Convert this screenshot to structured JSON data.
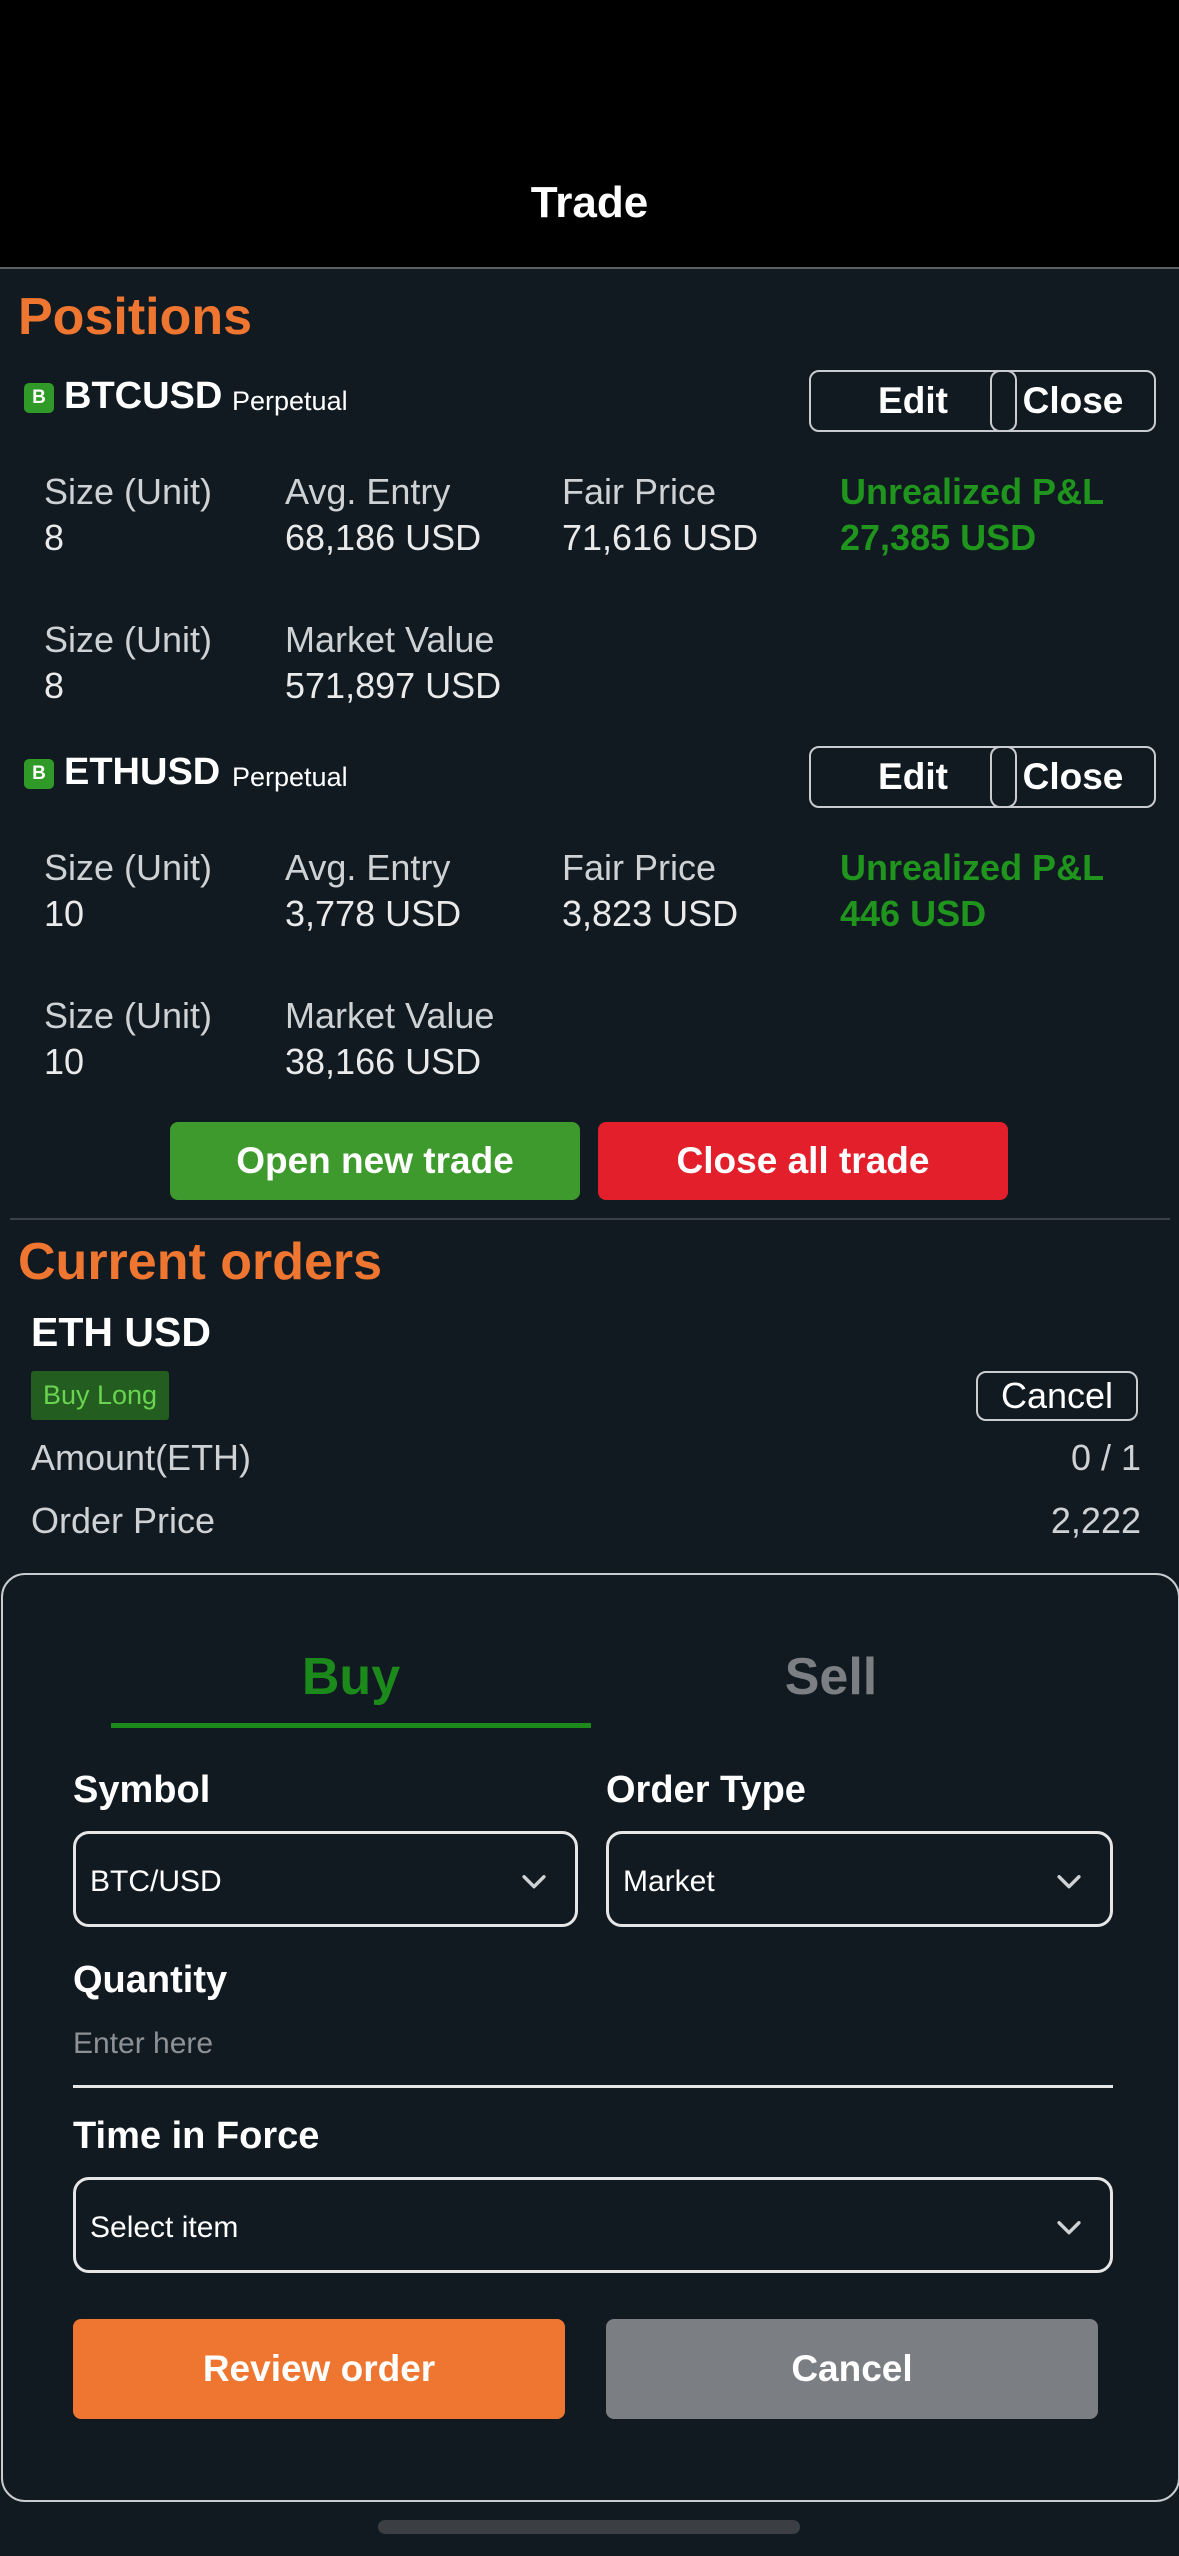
{
  "header": {
    "title": "Trade"
  },
  "positions": {
    "title": "Positions",
    "items": [
      {
        "badge": "B",
        "symbol": "BTCUSD",
        "type": "Perpetual",
        "edit_label": "Edit",
        "close_label": "Close",
        "stats": [
          {
            "label": "Size (Unit)",
            "value": "8"
          },
          {
            "label": "Avg. Entry",
            "value": "68,186 USD"
          },
          {
            "label": "Fair Price",
            "value": "71,616 USD"
          },
          {
            "label": "Unrealized P&L",
            "value": "27,385 USD"
          },
          {
            "label": "Size (Unit)",
            "value": "8"
          },
          {
            "label": "Market Value",
            "value": "571,897 USD"
          }
        ]
      },
      {
        "badge": "B",
        "symbol": "ETHUSD",
        "type": "Perpetual",
        "edit_label": "Edit",
        "close_label": "Close",
        "stats": [
          {
            "label": "Size (Unit)",
            "value": "10"
          },
          {
            "label": "Avg. Entry",
            "value": "3,778 USD"
          },
          {
            "label": "Fair Price",
            "value": "3,823 USD"
          },
          {
            "label": "Unrealized P&L",
            "value": "446 USD"
          },
          {
            "label": "Size (Unit)",
            "value": "10"
          },
          {
            "label": "Market Value",
            "value": "38,166 USD"
          }
        ]
      }
    ],
    "open_new_label": "Open new trade",
    "close_all_label": "Close all trade"
  },
  "orders": {
    "title": "Current orders",
    "items": [
      {
        "symbol": "ETH USD",
        "side": "Buy Long",
        "cancel_label": "Cancel",
        "rows": [
          {
            "label": "Amount(ETH)",
            "value": "0 / 1"
          },
          {
            "label": "Order Price",
            "value": "2,222"
          }
        ]
      }
    ]
  },
  "order_form": {
    "tabs": [
      {
        "label": "Buy",
        "active": true,
        "color": "#1b8a1b"
      },
      {
        "label": "Sell",
        "active": false,
        "color": "#7b7f83"
      }
    ],
    "symbol_label": "Symbol",
    "symbol_value": "BTC/USD",
    "order_type_label": "Order Type",
    "order_type_value": "Market",
    "quantity_label": "Quantity",
    "quantity_placeholder": "Enter here",
    "time_in_force_label": "Time in Force",
    "time_in_force_value": "Select item",
    "review_label": "Review order",
    "cancel_label": "Cancel"
  },
  "colors": {
    "accent": "#ef7630",
    "positive": "#20951d",
    "open_button": "#3e9a2c",
    "close_button": "#e21f2b",
    "review_button": "#ef7630",
    "cancel_button": "#7b7f83"
  }
}
